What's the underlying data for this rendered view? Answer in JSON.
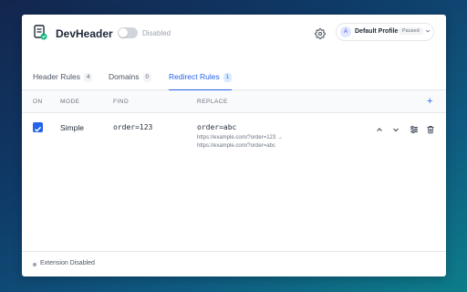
{
  "app": {
    "title": "DevHeader",
    "toggle_label": "Disabled"
  },
  "profile": {
    "initial": "A",
    "name": "Default Profile",
    "status": "Paused"
  },
  "tabs": [
    {
      "label": "Header Rules",
      "count": "4",
      "active": false
    },
    {
      "label": "Domains",
      "count": "0",
      "active": false
    },
    {
      "label": "Redirect Rules",
      "count": "1",
      "active": true
    }
  ],
  "table": {
    "columns": [
      "ON",
      "MODE",
      "FIND",
      "REPLACE"
    ],
    "add_label": "+",
    "rows": [
      {
        "enabled": true,
        "mode": "Simple",
        "find": "order=123",
        "replace": "order=abc",
        "preview_from": "https://example.com/?order=123 →",
        "preview_to": "https://example.com/?order=abc"
      }
    ]
  },
  "footer": {
    "status": "Extension Disabled"
  },
  "colors": {
    "accent": "#2563eb",
    "toggle_off": "#d1d5db",
    "status_dot": "#9ca3af"
  }
}
